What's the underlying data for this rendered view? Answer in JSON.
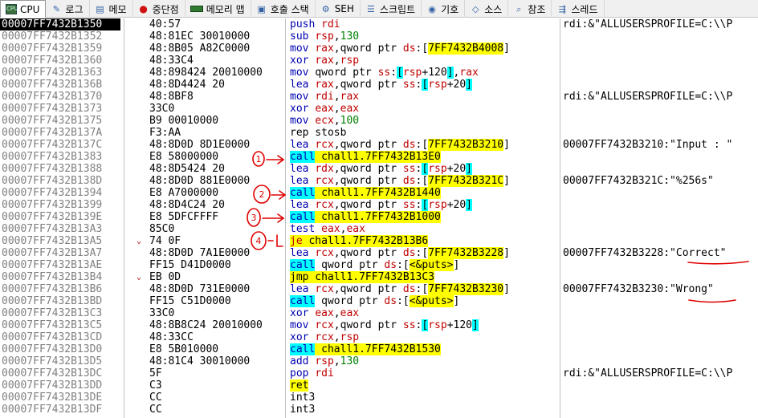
{
  "tabs": [
    {
      "label": "CPU",
      "icon": "cpu-icon",
      "active": true
    },
    {
      "label": "로그",
      "icon": "log-icon"
    },
    {
      "label": "메모",
      "icon": "notes-icon"
    },
    {
      "label": "중단점",
      "icon": "breakpoint-dot-icon"
    },
    {
      "label": "메모리 맵",
      "icon": "memory-map-icon"
    },
    {
      "label": "호출 스택",
      "icon": "call-stack-icon"
    },
    {
      "label": "SEH",
      "icon": "seh-icon"
    },
    {
      "label": "스크립트",
      "icon": "script-icon"
    },
    {
      "label": "기호",
      "icon": "symbols-icon"
    },
    {
      "label": "소스",
      "icon": "source-code-icon"
    },
    {
      "label": "참조",
      "icon": "references-icon"
    },
    {
      "label": "스레드",
      "icon": "threads-icon"
    }
  ],
  "colors": {
    "selected_row": "#000000",
    "highlight_yellow": "#ffff00",
    "highlight_cyan": "#00ffff",
    "annotation_red": "#e00000"
  },
  "annotations": [
    "1",
    "2",
    "3",
    "4"
  ],
  "rows": [
    {
      "addr": "00007FF7432B1350",
      "bytes": "40:57",
      "parts": [
        [
          "push ",
          "b"
        ],
        [
          "rdi",
          "r"
        ]
      ],
      "comment": "rdi:&\"ALLUSERSPROFILE=C:\\\\P",
      "selected": true
    },
    {
      "addr": "00007FF7432B1352",
      "bytes": "48:81EC 30010000",
      "parts": [
        [
          "sub ",
          "b"
        ],
        [
          "rsp",
          "r"
        ],
        [
          ",",
          ""
        ],
        [
          "130",
          "n"
        ]
      ],
      "comment": ""
    },
    {
      "addr": "00007FF7432B1359",
      "bytes": "48:8B05 A82C0000",
      "parts": [
        [
          "mov ",
          "b"
        ],
        [
          "rax",
          "r"
        ],
        [
          ",qword ptr ",
          ""
        ],
        [
          "ds",
          "r"
        ],
        [
          ":[",
          ""
        ],
        [
          "7FF7432B4008",
          "y"
        ],
        [
          "]",
          ""
        ]
      ],
      "comment": ""
    },
    {
      "addr": "00007FF7432B1360",
      "bytes": "48:33C4",
      "parts": [
        [
          "xor ",
          "b"
        ],
        [
          "rax",
          "r"
        ],
        [
          ",",
          ""
        ],
        [
          "rsp",
          "r"
        ]
      ],
      "comment": ""
    },
    {
      "addr": "00007FF7432B1363",
      "bytes": "48:898424 20010000",
      "parts": [
        [
          "mov ",
          "b"
        ],
        [
          "qword ptr ",
          ""
        ],
        [
          "ss",
          "r"
        ],
        [
          ":",
          ""
        ],
        [
          "[",
          "c"
        ],
        [
          "rsp",
          "r"
        ],
        [
          "+120",
          ""
        ],
        [
          "]",
          "c"
        ],
        [
          ",",
          ""
        ],
        [
          "rax",
          "r"
        ]
      ],
      "comment": ""
    },
    {
      "addr": "00007FF7432B136B",
      "bytes": "48:8D4424 20",
      "parts": [
        [
          "lea ",
          "b"
        ],
        [
          "rax",
          "r"
        ],
        [
          ",qword ptr ",
          ""
        ],
        [
          "ss",
          "r"
        ],
        [
          ":",
          ""
        ],
        [
          "[",
          "c"
        ],
        [
          "rsp",
          "r"
        ],
        [
          "+20",
          ""
        ],
        [
          "]",
          "c"
        ]
      ],
      "comment": ""
    },
    {
      "addr": "00007FF7432B1370",
      "bytes": "48:8BF8",
      "parts": [
        [
          "mov ",
          "b"
        ],
        [
          "rdi",
          "r"
        ],
        [
          ",",
          ""
        ],
        [
          "rax",
          "r"
        ]
      ],
      "comment": "rdi:&\"ALLUSERSPROFILE=C:\\\\P"
    },
    {
      "addr": "00007FF7432B1373",
      "bytes": "33C0",
      "parts": [
        [
          "xor ",
          "b"
        ],
        [
          "eax",
          "r"
        ],
        [
          ",",
          ""
        ],
        [
          "eax",
          "r"
        ]
      ],
      "comment": ""
    },
    {
      "addr": "00007FF7432B1375",
      "bytes": "B9 00010000",
      "parts": [
        [
          "mov ",
          "b"
        ],
        [
          "ecx",
          "r"
        ],
        [
          ",",
          ""
        ],
        [
          "100",
          "n"
        ]
      ],
      "comment": ""
    },
    {
      "addr": "00007FF7432B137A",
      "bytes": "F3:AA",
      "parts": [
        [
          "rep stosb",
          ""
        ]
      ],
      "comment": ""
    },
    {
      "addr": "00007FF7432B137C",
      "bytes": "48:8D0D 8D1E0000",
      "parts": [
        [
          "lea ",
          "b"
        ],
        [
          "rcx",
          "r"
        ],
        [
          ",qword ptr ",
          ""
        ],
        [
          "ds",
          "r"
        ],
        [
          ":[",
          ""
        ],
        [
          "7FF7432B3210",
          "y"
        ],
        [
          "]",
          ""
        ]
      ],
      "comment": "00007FF7432B3210:\"Input : \""
    },
    {
      "addr": "00007FF7432B1383",
      "bytes": "E8 58000000",
      "parts": [
        [
          "call",
          "cy"
        ],
        [
          " chall1.7FF7432B13E0",
          "y"
        ]
      ],
      "comment": ""
    },
    {
      "addr": "00007FF7432B1388",
      "bytes": "48:8D5424 20",
      "parts": [
        [
          "lea ",
          "b"
        ],
        [
          "rdx",
          "r"
        ],
        [
          ",qword ptr ",
          ""
        ],
        [
          "ss",
          "r"
        ],
        [
          ":",
          ""
        ],
        [
          "[",
          "c"
        ],
        [
          "rsp",
          "r"
        ],
        [
          "+20",
          ""
        ],
        [
          "]",
          "c"
        ]
      ],
      "comment": ""
    },
    {
      "addr": "00007FF7432B138D",
      "bytes": "48:8D0D 881E0000",
      "parts": [
        [
          "lea ",
          "b"
        ],
        [
          "rcx",
          "r"
        ],
        [
          ",qword ptr ",
          ""
        ],
        [
          "ds",
          "r"
        ],
        [
          ":[",
          ""
        ],
        [
          "7FF7432B321C",
          "y"
        ],
        [
          "]",
          ""
        ]
      ],
      "comment": "00007FF7432B321C:\"%256s\""
    },
    {
      "addr": "00007FF7432B1394",
      "bytes": "E8 A7000000",
      "parts": [
        [
          "call",
          "cy"
        ],
        [
          " chall1.7FF7432B1440",
          "y"
        ]
      ],
      "comment": ""
    },
    {
      "addr": "00007FF7432B1399",
      "bytes": "48:8D4C24 20",
      "parts": [
        [
          "lea ",
          "b"
        ],
        [
          "rcx",
          "r"
        ],
        [
          ",qword ptr ",
          ""
        ],
        [
          "ss",
          "r"
        ],
        [
          ":",
          ""
        ],
        [
          "[",
          "c"
        ],
        [
          "rsp",
          "r"
        ],
        [
          "+20",
          ""
        ],
        [
          "]",
          "c"
        ]
      ],
      "comment": ""
    },
    {
      "addr": "00007FF7432B139E",
      "bytes": "E8 5DFCFFFF",
      "parts": [
        [
          "call",
          "cy"
        ],
        [
          " chall1.7FF7432B1000",
          "y"
        ]
      ],
      "comment": ""
    },
    {
      "addr": "00007FF7432B13A3",
      "bytes": "85C0",
      "parts": [
        [
          "test ",
          "b"
        ],
        [
          "eax",
          "r"
        ],
        [
          ",",
          ""
        ],
        [
          "eax",
          "r"
        ]
      ],
      "comment": ""
    },
    {
      "addr": "00007FF7432B13A5",
      "bytes": "74 0F",
      "arrow": "⌄",
      "parts": [
        [
          "je",
          "ry"
        ],
        [
          " chall1.7FF7432B13B6",
          "y"
        ]
      ],
      "comment": ""
    },
    {
      "addr": "00007FF7432B13A7",
      "bytes": "48:8D0D 7A1E0000",
      "parts": [
        [
          "lea ",
          "b"
        ],
        [
          "rcx",
          "r"
        ],
        [
          ",qword ptr ",
          ""
        ],
        [
          "ds",
          "r"
        ],
        [
          ":[",
          ""
        ],
        [
          "7FF7432B3228",
          "y"
        ],
        [
          "]",
          ""
        ]
      ],
      "comment": "00007FF7432B3228:\"Correct\""
    },
    {
      "addr": "00007FF7432B13AE",
      "bytes": "FF15 D41D0000",
      "parts": [
        [
          "call",
          "cy"
        ],
        [
          " qword ptr ",
          ""
        ],
        [
          "ds",
          "r"
        ],
        [
          ":[",
          ""
        ],
        [
          "<&puts>",
          "y"
        ],
        [
          "]",
          ""
        ]
      ],
      "comment": ""
    },
    {
      "addr": "00007FF7432B13B4",
      "bytes": "EB 0D",
      "arrow": "⌄",
      "parts": [
        [
          "jmp",
          "y"
        ],
        [
          " chall1.7FF7432B13C3",
          "y"
        ]
      ],
      "comment": ""
    },
    {
      "addr": "00007FF7432B13B6",
      "bytes": "48:8D0D 731E0000",
      "parts": [
        [
          "lea ",
          "b"
        ],
        [
          "rcx",
          "r"
        ],
        [
          ",qword ptr ",
          ""
        ],
        [
          "ds",
          "r"
        ],
        [
          ":[",
          ""
        ],
        [
          "7FF7432B3230",
          "y"
        ],
        [
          "]",
          ""
        ]
      ],
      "comment": "00007FF7432B3230:\"Wrong\""
    },
    {
      "addr": "00007FF7432B13BD",
      "bytes": "FF15 C51D0000",
      "parts": [
        [
          "call",
          "cy"
        ],
        [
          " qword ptr ",
          ""
        ],
        [
          "ds",
          "r"
        ],
        [
          ":[",
          ""
        ],
        [
          "<&puts>",
          "y"
        ],
        [
          "]",
          ""
        ]
      ],
      "comment": ""
    },
    {
      "addr": "00007FF7432B13C3",
      "bytes": "33C0",
      "parts": [
        [
          "xor ",
          "b"
        ],
        [
          "eax",
          "r"
        ],
        [
          ",",
          ""
        ],
        [
          "eax",
          "r"
        ]
      ],
      "comment": ""
    },
    {
      "addr": "00007FF7432B13C5",
      "bytes": "48:8B8C24 20010000",
      "parts": [
        [
          "mov ",
          "b"
        ],
        [
          "rcx",
          "r"
        ],
        [
          ",qword ptr ",
          ""
        ],
        [
          "ss",
          "r"
        ],
        [
          ":",
          ""
        ],
        [
          "[",
          "c"
        ],
        [
          "rsp",
          "r"
        ],
        [
          "+120",
          ""
        ],
        [
          "]",
          "c"
        ]
      ],
      "comment": ""
    },
    {
      "addr": "00007FF7432B13CD",
      "bytes": "48:33CC",
      "parts": [
        [
          "xor ",
          "b"
        ],
        [
          "rcx",
          "r"
        ],
        [
          ",",
          ""
        ],
        [
          "rsp",
          "r"
        ]
      ],
      "comment": ""
    },
    {
      "addr": "00007FF7432B13D0",
      "bytes": "E8 5B010000",
      "parts": [
        [
          "call",
          "cy"
        ],
        [
          " chall1.7FF7432B1530",
          "y"
        ]
      ],
      "comment": ""
    },
    {
      "addr": "00007FF7432B13D5",
      "bytes": "48:81C4 30010000",
      "parts": [
        [
          "add ",
          "b"
        ],
        [
          "rsp",
          "r"
        ],
        [
          ",",
          ""
        ],
        [
          "130",
          "n"
        ]
      ],
      "comment": ""
    },
    {
      "addr": "00007FF7432B13DC",
      "bytes": "5F",
      "parts": [
        [
          "pop ",
          "b"
        ],
        [
          "rdi",
          "r"
        ]
      ],
      "comment": "rdi:&\"ALLUSERSPROFILE=C:\\\\P"
    },
    {
      "addr": "00007FF7432B13DD",
      "bytes": "C3",
      "parts": [
        [
          "ret",
          "y"
        ]
      ],
      "comment": ""
    },
    {
      "addr": "00007FF7432B13DE",
      "bytes": "CC",
      "parts": [
        [
          "int3",
          ""
        ]
      ],
      "comment": ""
    },
    {
      "addr": "00007FF7432B13DF",
      "bytes": "CC",
      "parts": [
        [
          "int3",
          ""
        ]
      ],
      "comment": ""
    }
  ]
}
